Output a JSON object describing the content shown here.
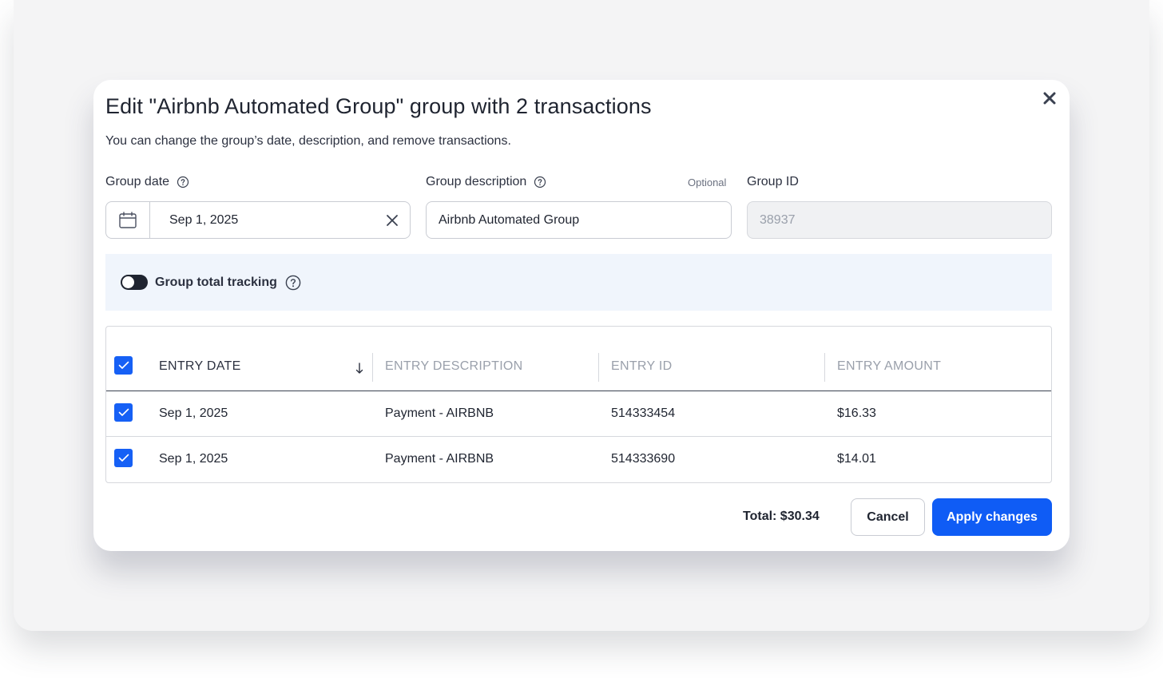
{
  "dialog": {
    "title": "Edit \"Airbnb Automated Group\" group with 2 transactions",
    "subtitle": "You can change the group’s date, description, and remove transactions.",
    "close_icon": "close-icon"
  },
  "fields": {
    "group_date": {
      "label": "Group date",
      "value": "Sep 1, 2025",
      "icon": "calendar-icon",
      "clear_icon": "x-icon"
    },
    "group_description": {
      "label": "Group description",
      "optional_text": "Optional",
      "value": "Airbnb Automated Group"
    },
    "group_id": {
      "label": "Group ID",
      "value": "38937"
    }
  },
  "tracking": {
    "label": "Group total tracking",
    "enabled": false
  },
  "table": {
    "headers": {
      "entry_date": "ENTRY DATE",
      "entry_description": "ENTRY DESCRIPTION",
      "entry_id": "ENTRY ID",
      "entry_amount": "ENTRY AMOUNT"
    },
    "sort": {
      "column": "entry_date",
      "direction": "desc"
    },
    "rows": [
      {
        "checked": true,
        "date": "Sep 1, 2025",
        "description": "Payment - AIRBNB",
        "id": "514333454",
        "amount": "$16.33"
      },
      {
        "checked": true,
        "date": "Sep 1, 2025",
        "description": "Payment - AIRBNB",
        "id": "514333690",
        "amount": "$14.01"
      }
    ]
  },
  "footer": {
    "total": "Total: $30.34",
    "cancel_label": "Cancel",
    "apply_label": "Apply changes"
  },
  "colors": {
    "primary": "#0f5cf5",
    "checkbox": "#1660f5",
    "panel_bg": "#f0f5fc",
    "text": "#1f2430"
  }
}
